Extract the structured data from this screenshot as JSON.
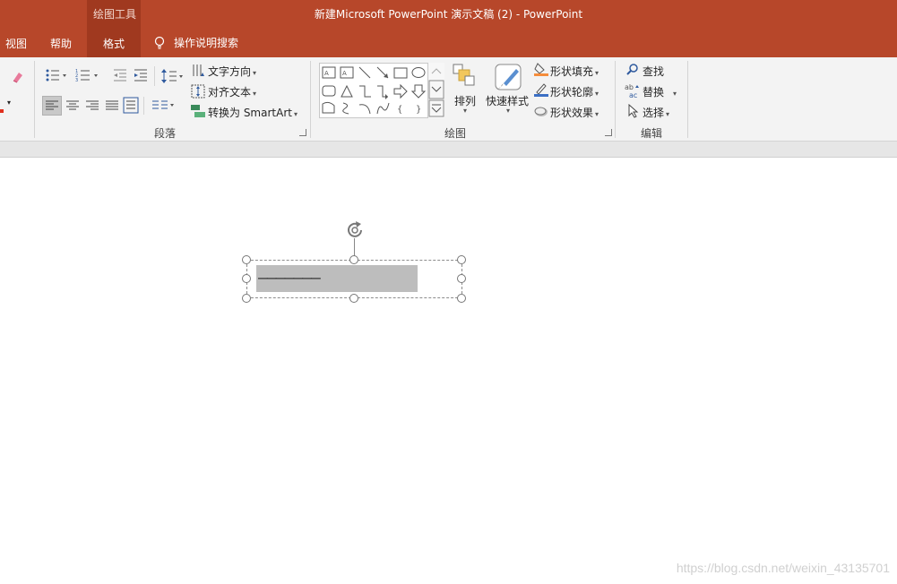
{
  "window": {
    "title": "新建Microsoft PowerPoint 演示文稿 (2)  -  PowerPoint",
    "context_group": "绘图工具"
  },
  "tabs": [
    {
      "label": "视图",
      "active": false
    },
    {
      "label": "帮助",
      "active": false
    },
    {
      "label": "格式",
      "active": true
    }
  ],
  "tell_me": {
    "label": "操作说明搜索",
    "icon": "lightbulb-icon"
  },
  "ribbon": {
    "paragraph": {
      "label": "段落",
      "text_direction": "文字方向",
      "align_text": "对齐文本",
      "convert_smartart": "转换为 SmartArt"
    },
    "drawing": {
      "label": "绘图",
      "arrange": "排列",
      "quick_styles": "快速样式",
      "shape_fill": "形状填充",
      "shape_outline": "形状轮廓",
      "shape_effects": "形状效果"
    },
    "editing": {
      "label": "编辑",
      "find": "查找",
      "replace": "替换",
      "select": "选择"
    }
  },
  "slide": {
    "textbox_content": "———————"
  },
  "watermark": "https://blog.csdn.net/weixin_43135701",
  "colors": {
    "titlebar": "#b7472a",
    "active_tab": "#a0391f",
    "ribbon": "#f3f3f3"
  }
}
